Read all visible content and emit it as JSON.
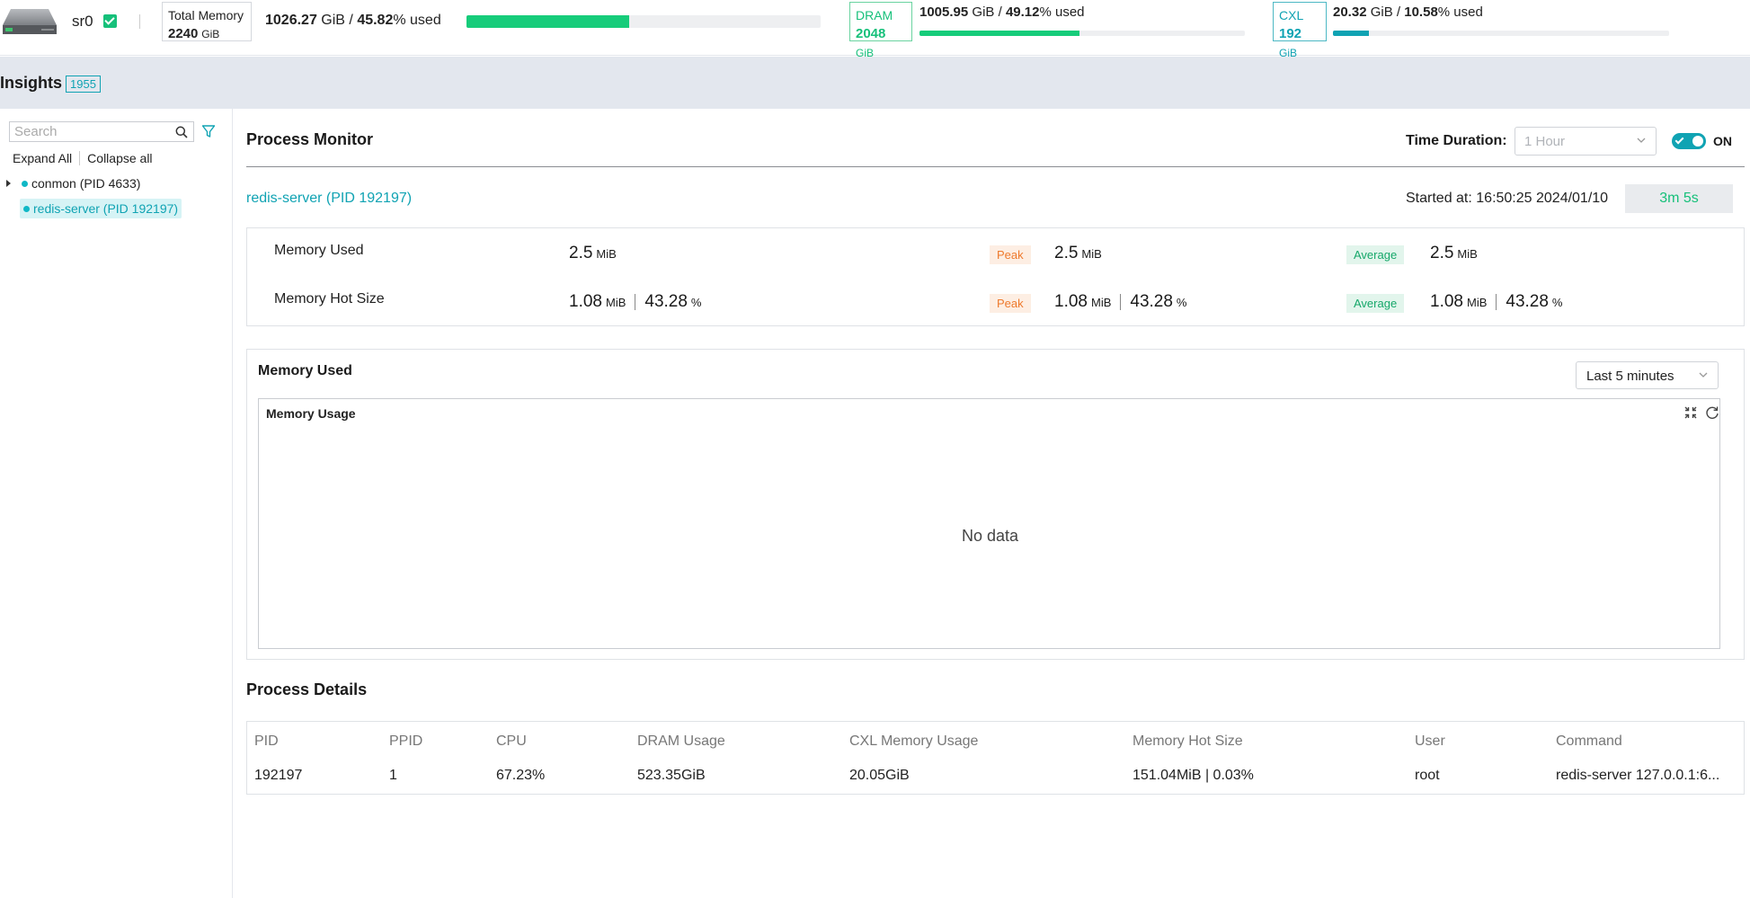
{
  "topbar": {
    "server_name": "sr0",
    "total": {
      "label": "Total Memory",
      "capacity": "2240",
      "unit": "GiB",
      "used": "1026.27",
      "used_unit": "GiB",
      "percent": "45.82",
      "used_suffix": "% used",
      "fill": 0.4582
    },
    "dram": {
      "label": "DRAM",
      "capacity": "2048",
      "unit": "GiB",
      "used": "1005.95",
      "used_unit": "GiB",
      "percent": "49.12",
      "used_suffix": "% used",
      "fill": 0.4912
    },
    "cxl": {
      "label": "CXL",
      "capacity": "192",
      "unit": "GiB",
      "used": "20.32",
      "used_unit": "GiB",
      "percent": "10.58",
      "used_suffix": "% used",
      "fill": 0.1058
    }
  },
  "insights": {
    "title": "Insights",
    "badge": "1955"
  },
  "sidebar": {
    "search_placeholder": "Search",
    "expand_all": "Expand All",
    "collapse_all": "Collapse all",
    "items": [
      {
        "label": "conmon (PID 4633)"
      },
      {
        "label": "redis-server (PID 192197)"
      }
    ]
  },
  "monitor": {
    "title": "Process Monitor",
    "time_duration_label": "Time Duration:",
    "time_duration_value": "1 Hour",
    "toggle_label": "ON",
    "process_name": "redis-server (PID 192197)",
    "started_at": "Started at: 16:50:25 2024/01/10",
    "elapsed": "3m 5s"
  },
  "stats": {
    "memory_used": {
      "label": "Memory Used",
      "value": "2.5",
      "unit": "MiB",
      "peak_tag": "Peak",
      "peak": "2.5",
      "peak_unit": "MiB",
      "avg_tag": "Average",
      "avg": "2.5",
      "avg_unit": "MiB"
    },
    "memory_hot": {
      "label": "Memory Hot Size",
      "value": "1.08",
      "unit": "MiB",
      "pct": "43.28",
      "pct_unit": "%",
      "peak_tag": "Peak",
      "peak": "1.08",
      "peak_unit": "MiB",
      "peak_pct": "43.28",
      "avg_tag": "Average",
      "avg": "1.08",
      "avg_unit": "MiB",
      "avg_pct": "43.28"
    }
  },
  "chart_section": {
    "title": "Memory Used",
    "range": "Last 5 minutes",
    "chart_title": "Memory Usage",
    "empty_text": "No data"
  },
  "details": {
    "title": "Process Details",
    "columns": [
      "PID",
      "PPID",
      "CPU",
      "DRAM Usage",
      "CXL Memory Usage",
      "Memory Hot Size",
      "User",
      "Command"
    ],
    "rows": [
      [
        "192197",
        "1",
        "67.23%",
        "523.35GiB",
        "20.05GiB",
        "151.04MiB | 0.03%",
        "root",
        "redis-server 127.0.0.1:6..."
      ]
    ]
  }
}
